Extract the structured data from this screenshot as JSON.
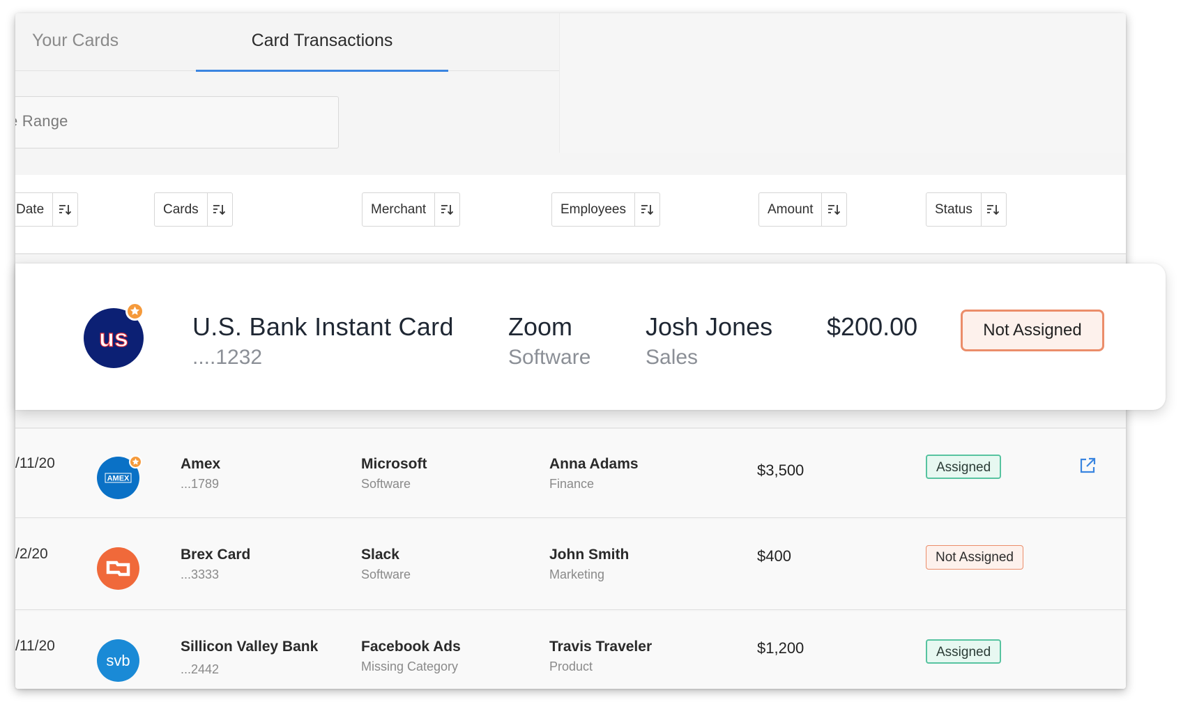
{
  "tabs": {
    "your_cards": "Your Cards",
    "card_transactions": "Card Transactions"
  },
  "date_range": {
    "label": "e Range"
  },
  "filters": [
    {
      "label": "Date"
    },
    {
      "label": "Cards"
    },
    {
      "label": "Merchant"
    },
    {
      "label": "Employees"
    },
    {
      "label": "Amount"
    },
    {
      "label": "Status"
    }
  ],
  "featured": {
    "logo_text": "us",
    "card_name": "U.S. Bank Instant Card",
    "card_number": "....1232",
    "merchant": "Zoom",
    "category": "Software",
    "employee": "Josh Jones",
    "department": "Sales",
    "amount": "$200.00",
    "status": "Not Assigned"
  },
  "rows": [
    {
      "date": "/11/20",
      "logo_text": "AMEX",
      "card": "Amex",
      "number": "...1789",
      "merchant": "Microsoft",
      "category": "Software",
      "employee": "Anna Adams",
      "department": "Finance",
      "amount": "$3,500",
      "status": "Assigned"
    },
    {
      "date": "/2/20",
      "logo_text": "",
      "card": "Brex Card",
      "number": "...3333",
      "merchant": "Slack",
      "category": "Software",
      "employee": "John Smith",
      "department": "Marketing",
      "amount": "$400",
      "status": "Not Assigned"
    },
    {
      "date": "/11/20",
      "logo_text": "svb",
      "card": "Sillicon Valley Bank",
      "number": "...2442",
      "merchant": "Facebook Ads",
      "category": "Missing Category",
      "employee": "Travis Traveler",
      "department": "Product",
      "amount": "$1,200",
      "status": "Assigned"
    }
  ],
  "colors": {
    "accent_blue": "#3a85e0",
    "assigned_green": "#57c3a0",
    "not_assigned_orange": "#eb8d6a",
    "usbank_navy": "#0c2074",
    "amex_blue": "#0a71c6",
    "brex_orange": "#f0693a",
    "svb_blue": "#1a8ad6",
    "star_orange": "#f59a3b"
  },
  "icons": {
    "sort": "sort-icon",
    "external_link": "external-link-icon",
    "star": "star-icon"
  }
}
